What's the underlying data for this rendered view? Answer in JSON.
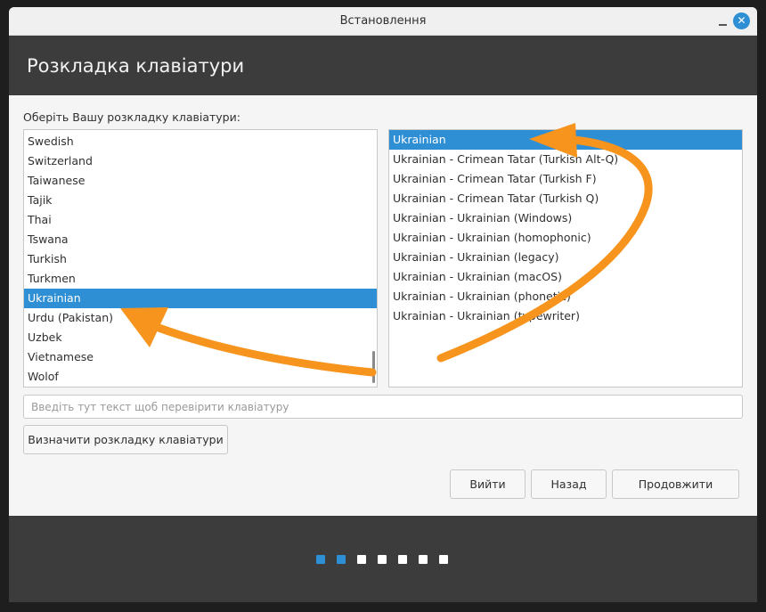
{
  "window": {
    "title": "Встановлення",
    "close_glyph": "✕"
  },
  "header": {
    "title": "Розкладка клавіатури"
  },
  "main": {
    "prompt": "Оберіть Вашу розкладку клавіатури:",
    "layouts": [
      {
        "label": "Swedish",
        "selected": false
      },
      {
        "label": "Switzerland",
        "selected": false
      },
      {
        "label": "Taiwanese",
        "selected": false
      },
      {
        "label": "Tajik",
        "selected": false
      },
      {
        "label": "Thai",
        "selected": false
      },
      {
        "label": "Tswana",
        "selected": false
      },
      {
        "label": "Turkish",
        "selected": false
      },
      {
        "label": "Turkmen",
        "selected": false
      },
      {
        "label": "Ukrainian",
        "selected": true
      },
      {
        "label": "Urdu (Pakistan)",
        "selected": false
      },
      {
        "label": "Uzbek",
        "selected": false
      },
      {
        "label": "Vietnamese",
        "selected": false
      },
      {
        "label": "Wolof",
        "selected": false
      }
    ],
    "variants": [
      {
        "label": "Ukrainian",
        "selected": true
      },
      {
        "label": "Ukrainian - Crimean Tatar (Turkish Alt-Q)",
        "selected": false
      },
      {
        "label": "Ukrainian - Crimean Tatar (Turkish F)",
        "selected": false
      },
      {
        "label": "Ukrainian - Crimean Tatar (Turkish Q)",
        "selected": false
      },
      {
        "label": "Ukrainian - Ukrainian (Windows)",
        "selected": false
      },
      {
        "label": "Ukrainian - Ukrainian (homophonic)",
        "selected": false
      },
      {
        "label": "Ukrainian - Ukrainian (legacy)",
        "selected": false
      },
      {
        "label": "Ukrainian - Ukrainian (macOS)",
        "selected": false
      },
      {
        "label": "Ukrainian - Ukrainian (phonetic)",
        "selected": false
      },
      {
        "label": "Ukrainian - Ukrainian (typewriter)",
        "selected": false
      }
    ],
    "test_input": {
      "value": "",
      "placeholder": "Введіть тут текст щоб перевірити клавіатуру"
    },
    "detect_button": "Визначити розкладку клавіатури"
  },
  "buttons": {
    "quit": "Вийти",
    "back": "Назад",
    "continue": "Продовжити"
  },
  "progress": {
    "total_steps": 7,
    "completed_steps": 2
  },
  "colors": {
    "accent": "#2f8fd5",
    "annotation_arrow": "#f7941d",
    "header_bg": "#3c3c3c"
  }
}
